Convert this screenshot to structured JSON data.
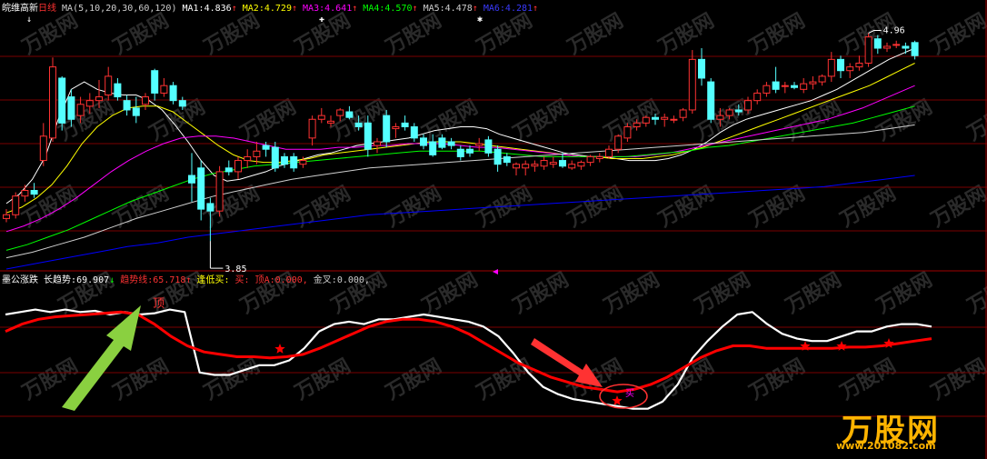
{
  "colors": {
    "up": "#ff3232",
    "down": "#54ffff",
    "grid": "#7a0000",
    "bg": "#000000",
    "ma1": "#ffffff",
    "ma2": "#ffff00",
    "ma3": "#ff00ff",
    "ma4": "#00ff00",
    "ma5": "#cfcfcf",
    "ma6": "#0000ff",
    "long_trend": "#ffffff",
    "trend_line": "#ff0000",
    "star": "#ff0000"
  },
  "upper": {
    "stock_name": "皖维高新",
    "period": "日线",
    "ma_params": "MA(5,10,20,30,60,120)",
    "ma_values": [
      {
        "label": "MA1:",
        "value": "4.836",
        "arrow": "↑"
      },
      {
        "label": "MA2:",
        "value": "4.729",
        "arrow": "↑"
      },
      {
        "label": "MA3:",
        "value": "4.641",
        "arrow": "↑"
      },
      {
        "label": "MA4:",
        "value": "4.570",
        "arrow": "↑"
      },
      {
        "label": "MA5:",
        "value": "4.478",
        "arrow": "↑"
      },
      {
        "label": "MA6:",
        "value": "4.281",
        "arrow": "↑"
      }
    ],
    "high_label": "4.96",
    "low_label": "3.85"
  },
  "lower": {
    "indicator_name": "墨公涨跌",
    "long_trend_label": "长趋势:",
    "long_trend_value": "69.907",
    "long_trend_arrow": "↓",
    "trend_line_label": "趋势线:",
    "trend_line_value": "65.718",
    "trend_line_arrow": "↑",
    "buy_low_label": "逢低买:",
    "buy_label": "买:",
    "top_label": "顶A:",
    "top_value": "0.000,",
    "golden_label": "金叉:",
    "golden_value": "0.000,",
    "top_marker": "顶",
    "buy_marker": "买"
  },
  "watermark": {
    "brand": "万股网",
    "url": "www.201082.com"
  },
  "chart_data": {
    "type": "candlestick",
    "price_range": [
      3.7,
      5.05
    ],
    "candles": [
      {
        "o": 3.97,
        "h": 4.02,
        "l": 3.95,
        "c": 3.99
      },
      {
        "o": 3.99,
        "h": 4.11,
        "l": 3.97,
        "c": 4.09
      },
      {
        "o": 4.09,
        "h": 4.15,
        "l": 4.06,
        "c": 4.12
      },
      {
        "o": 4.12,
        "h": 4.16,
        "l": 4.08,
        "c": 4.1
      },
      {
        "o": 4.28,
        "h": 4.48,
        "l": 4.25,
        "c": 4.41
      },
      {
        "o": 4.4,
        "h": 4.83,
        "l": 4.38,
        "c": 4.78
      },
      {
        "o": 4.72,
        "h": 4.73,
        "l": 4.44,
        "c": 4.48
      },
      {
        "o": 4.62,
        "h": 4.66,
        "l": 4.46,
        "c": 4.5
      },
      {
        "o": 4.52,
        "h": 4.62,
        "l": 4.48,
        "c": 4.58
      },
      {
        "o": 4.57,
        "h": 4.64,
        "l": 4.53,
        "c": 4.6
      },
      {
        "o": 4.6,
        "h": 4.71,
        "l": 4.56,
        "c": 4.62
      },
      {
        "o": 4.63,
        "h": 4.78,
        "l": 4.6,
        "c": 4.73
      },
      {
        "o": 4.69,
        "h": 4.72,
        "l": 4.6,
        "c": 4.62
      },
      {
        "o": 4.6,
        "h": 4.63,
        "l": 4.52,
        "c": 4.55
      },
      {
        "o": 4.56,
        "h": 4.62,
        "l": 4.48,
        "c": 4.52
      },
      {
        "o": 4.58,
        "h": 4.64,
        "l": 4.55,
        "c": 4.62
      },
      {
        "o": 4.76,
        "h": 4.77,
        "l": 4.6,
        "c": 4.64
      },
      {
        "o": 4.64,
        "h": 4.72,
        "l": 4.62,
        "c": 4.68
      },
      {
        "o": 4.68,
        "h": 4.7,
        "l": 4.58,
        "c": 4.6
      },
      {
        "o": 4.6,
        "h": 4.62,
        "l": 4.55,
        "c": 4.57
      },
      {
        "o": 4.2,
        "h": 4.32,
        "l": 4.06,
        "c": 4.16
      },
      {
        "o": 4.24,
        "h": 4.28,
        "l": 3.96,
        "c": 4.02
      },
      {
        "o": 4.05,
        "h": 4.08,
        "l": 3.85,
        "c": 4.01
      },
      {
        "o": 4.01,
        "h": 4.25,
        "l": 3.98,
        "c": 4.22
      },
      {
        "o": 4.24,
        "h": 4.28,
        "l": 4.2,
        "c": 4.22
      },
      {
        "o": 4.22,
        "h": 4.3,
        "l": 4.18,
        "c": 4.28
      },
      {
        "o": 4.28,
        "h": 4.34,
        "l": 4.24,
        "c": 4.3
      },
      {
        "o": 4.3,
        "h": 4.38,
        "l": 4.26,
        "c": 4.33
      },
      {
        "o": 4.36,
        "h": 4.38,
        "l": 4.3,
        "c": 4.34
      },
      {
        "o": 4.35,
        "h": 4.38,
        "l": 4.22,
        "c": 4.24
      },
      {
        "o": 4.3,
        "h": 4.32,
        "l": 4.24,
        "c": 4.26
      },
      {
        "o": 4.3,
        "h": 4.32,
        "l": 4.22,
        "c": 4.24
      },
      {
        "o": 4.26,
        "h": 4.3,
        "l": 4.24,
        "c": 4.28
      },
      {
        "o": 4.4,
        "h": 4.52,
        "l": 4.36,
        "c": 4.5
      },
      {
        "o": 4.5,
        "h": 4.56,
        "l": 4.48,
        "c": 4.52
      },
      {
        "o": 4.48,
        "h": 4.52,
        "l": 4.46,
        "c": 4.49
      },
      {
        "o": 4.52,
        "h": 4.56,
        "l": 4.49,
        "c": 4.55
      },
      {
        "o": 4.54,
        "h": 4.57,
        "l": 4.5,
        "c": 4.51
      },
      {
        "o": 4.48,
        "h": 4.52,
        "l": 4.44,
        "c": 4.46
      },
      {
        "o": 4.48,
        "h": 4.52,
        "l": 4.3,
        "c": 4.34
      },
      {
        "o": 4.36,
        "h": 4.4,
        "l": 4.32,
        "c": 4.38
      },
      {
        "o": 4.52,
        "h": 4.55,
        "l": 4.35,
        "c": 4.38
      },
      {
        "o": 4.45,
        "h": 4.48,
        "l": 4.4,
        "c": 4.46
      },
      {
        "o": 4.48,
        "h": 4.52,
        "l": 4.44,
        "c": 4.46
      },
      {
        "o": 4.46,
        "h": 4.48,
        "l": 4.38,
        "c": 4.4
      },
      {
        "o": 4.4,
        "h": 4.42,
        "l": 4.34,
        "c": 4.36
      },
      {
        "o": 4.38,
        "h": 4.42,
        "l": 4.3,
        "c": 4.31
      },
      {
        "o": 4.4,
        "h": 4.42,
        "l": 4.34,
        "c": 4.35
      },
      {
        "o": 4.38,
        "h": 4.4,
        "l": 4.34,
        "c": 4.36
      },
      {
        "o": 4.34,
        "h": 4.36,
        "l": 4.28,
        "c": 4.3
      },
      {
        "o": 4.34,
        "h": 4.36,
        "l": 4.3,
        "c": 4.32
      },
      {
        "o": 4.36,
        "h": 4.4,
        "l": 4.33,
        "c": 4.37
      },
      {
        "o": 4.39,
        "h": 4.41,
        "l": 4.3,
        "c": 4.32
      },
      {
        "o": 4.34,
        "h": 4.36,
        "l": 4.22,
        "c": 4.26
      },
      {
        "o": 4.3,
        "h": 4.32,
        "l": 4.25,
        "c": 4.27
      },
      {
        "o": 4.24,
        "h": 4.27,
        "l": 4.2,
        "c": 4.26
      },
      {
        "o": 4.24,
        "h": 4.28,
        "l": 4.2,
        "c": 4.26
      },
      {
        "o": 4.25,
        "h": 4.28,
        "l": 4.22,
        "c": 4.26
      },
      {
        "o": 4.25,
        "h": 4.3,
        "l": 4.23,
        "c": 4.28
      },
      {
        "o": 4.26,
        "h": 4.3,
        "l": 4.24,
        "c": 4.27
      },
      {
        "o": 4.28,
        "h": 4.32,
        "l": 4.24,
        "c": 4.25
      },
      {
        "o": 4.24,
        "h": 4.28,
        "l": 4.23,
        "c": 4.26
      },
      {
        "o": 4.25,
        "h": 4.28,
        "l": 4.23,
        "c": 4.27
      },
      {
        "o": 4.27,
        "h": 4.31,
        "l": 4.25,
        "c": 4.3
      },
      {
        "o": 4.29,
        "h": 4.32,
        "l": 4.27,
        "c": 4.3
      },
      {
        "o": 4.3,
        "h": 4.36,
        "l": 4.29,
        "c": 4.34
      },
      {
        "o": 4.34,
        "h": 4.42,
        "l": 4.32,
        "c": 4.41
      },
      {
        "o": 4.4,
        "h": 4.48,
        "l": 4.38,
        "c": 4.46
      },
      {
        "o": 4.46,
        "h": 4.5,
        "l": 4.44,
        "c": 4.48
      },
      {
        "o": 4.48,
        "h": 4.52,
        "l": 4.46,
        "c": 4.51
      },
      {
        "o": 4.51,
        "h": 4.53,
        "l": 4.47,
        "c": 4.5
      },
      {
        "o": 4.5,
        "h": 4.53,
        "l": 4.46,
        "c": 4.51
      },
      {
        "o": 4.5,
        "h": 4.52,
        "l": 4.48,
        "c": 4.5
      },
      {
        "o": 4.51,
        "h": 4.56,
        "l": 4.49,
        "c": 4.55
      },
      {
        "o": 4.55,
        "h": 4.87,
        "l": 4.53,
        "c": 4.82
      },
      {
        "o": 4.82,
        "h": 4.88,
        "l": 4.68,
        "c": 4.72
      },
      {
        "o": 4.7,
        "h": 4.72,
        "l": 4.48,
        "c": 4.5
      },
      {
        "o": 4.5,
        "h": 4.56,
        "l": 4.46,
        "c": 4.52
      },
      {
        "o": 4.52,
        "h": 4.56,
        "l": 4.5,
        "c": 4.55
      },
      {
        "o": 4.55,
        "h": 4.58,
        "l": 4.52,
        "c": 4.54
      },
      {
        "o": 4.55,
        "h": 4.62,
        "l": 4.53,
        "c": 4.6
      },
      {
        "o": 4.6,
        "h": 4.66,
        "l": 4.58,
        "c": 4.64
      },
      {
        "o": 4.64,
        "h": 4.7,
        "l": 4.62,
        "c": 4.68
      },
      {
        "o": 4.7,
        "h": 4.78,
        "l": 4.64,
        "c": 4.66
      },
      {
        "o": 4.68,
        "h": 4.7,
        "l": 4.64,
        "c": 4.68
      },
      {
        "o": 4.68,
        "h": 4.7,
        "l": 4.66,
        "c": 4.67
      },
      {
        "o": 4.66,
        "h": 4.72,
        "l": 4.64,
        "c": 4.69
      },
      {
        "o": 4.69,
        "h": 4.73,
        "l": 4.66,
        "c": 4.7
      },
      {
        "o": 4.7,
        "h": 4.74,
        "l": 4.68,
        "c": 4.73
      },
      {
        "o": 4.73,
        "h": 4.86,
        "l": 4.7,
        "c": 4.82
      },
      {
        "o": 4.82,
        "h": 4.84,
        "l": 4.72,
        "c": 4.76
      },
      {
        "o": 4.76,
        "h": 4.8,
        "l": 4.72,
        "c": 4.78
      },
      {
        "o": 4.78,
        "h": 4.84,
        "l": 4.76,
        "c": 4.8
      },
      {
        "o": 4.8,
        "h": 4.96,
        "l": 4.78,
        "c": 4.94
      },
      {
        "o": 4.93,
        "h": 4.95,
        "l": 4.85,
        "c": 4.88
      },
      {
        "o": 4.88,
        "h": 4.91,
        "l": 4.86,
        "c": 4.89
      },
      {
        "o": 4.9,
        "h": 4.92,
        "l": 4.88,
        "c": 4.9
      },
      {
        "o": 4.89,
        "h": 4.91,
        "l": 4.85,
        "c": 4.88
      },
      {
        "o": 4.91,
        "h": 4.92,
        "l": 4.82,
        "c": 4.84
      }
    ],
    "ma_series": [
      {
        "name": "MA1",
        "values": [
          4.05,
          4.1,
          4.18,
          4.3,
          4.5,
          4.66,
          4.7,
          4.66,
          4.64,
          4.63,
          4.63,
          4.6,
          4.55,
          4.47,
          4.38,
          4.28,
          4.2,
          4.17,
          4.18,
          4.2,
          4.22,
          4.25,
          4.27,
          4.29,
          4.31,
          4.32,
          4.34,
          4.36,
          4.37,
          4.38,
          4.39,
          4.4,
          4.42,
          4.44,
          4.45,
          4.46,
          4.46,
          4.45,
          4.42,
          4.4,
          4.38,
          4.36,
          4.34,
          4.32,
          4.31,
          4.3,
          4.3,
          4.29,
          4.28,
          4.28,
          4.28,
          4.29,
          4.31,
          4.34,
          4.38,
          4.43,
          4.47,
          4.5,
          4.52,
          4.54,
          4.56,
          4.58,
          4.6,
          4.63,
          4.66,
          4.7,
          4.74,
          4.78,
          4.82,
          4.85,
          4.88
        ]
      },
      {
        "name": "MA2",
        "values": [
          4.0,
          4.03,
          4.08,
          4.15,
          4.25,
          4.37,
          4.46,
          4.52,
          4.56,
          4.57,
          4.57,
          4.54,
          4.48,
          4.42,
          4.36,
          4.31,
          4.28,
          4.27,
          4.27,
          4.28,
          4.29,
          4.31,
          4.32,
          4.33,
          4.34,
          4.35,
          4.36,
          4.37,
          4.38,
          4.38,
          4.38,
          4.37,
          4.36,
          4.35,
          4.34,
          4.33,
          4.32,
          4.31,
          4.3,
          4.3,
          4.29,
          4.29,
          4.29,
          4.3,
          4.31,
          4.33,
          4.35,
          4.38,
          4.41,
          4.44,
          4.47,
          4.5,
          4.53,
          4.56,
          4.59,
          4.62,
          4.65,
          4.68,
          4.72,
          4.76,
          4.8
        ]
      },
      {
        "name": "MA3",
        "values": [
          3.9,
          3.93,
          3.97,
          4.02,
          4.08,
          4.15,
          4.22,
          4.28,
          4.33,
          4.37,
          4.4,
          4.41,
          4.41,
          4.4,
          4.38,
          4.36,
          4.34,
          4.34,
          4.34,
          4.35,
          4.35,
          4.36,
          4.36,
          4.37,
          4.37,
          4.37,
          4.36,
          4.35,
          4.35,
          4.34,
          4.33,
          4.32,
          4.31,
          4.3,
          4.3,
          4.3,
          4.3,
          4.31,
          4.32,
          4.34,
          4.36,
          4.38,
          4.4,
          4.42,
          4.44,
          4.46,
          4.48,
          4.5,
          4.53,
          4.56,
          4.6,
          4.64,
          4.68
        ]
      },
      {
        "name": "MA4",
        "values": [
          3.8,
          3.83,
          3.87,
          3.91,
          3.96,
          4.01,
          4.06,
          4.1,
          4.14,
          4.18,
          4.21,
          4.23,
          4.25,
          4.26,
          4.27,
          4.28,
          4.29,
          4.3,
          4.31,
          4.32,
          4.33,
          4.33,
          4.33,
          4.33,
          4.32,
          4.31,
          4.3,
          4.3,
          4.3,
          4.3,
          4.3,
          4.31,
          4.32,
          4.33,
          4.35,
          4.36,
          4.38,
          4.4,
          4.42,
          4.44,
          4.46,
          4.48,
          4.51,
          4.54,
          4.57
        ]
      },
      {
        "name": "MA5",
        "values": [
          3.76,
          3.79,
          3.83,
          3.87,
          3.92,
          3.97,
          4.01,
          4.05,
          4.09,
          4.12,
          4.15,
          4.18,
          4.2,
          4.22,
          4.24,
          4.25,
          4.26,
          4.27,
          4.28,
          4.29,
          4.3,
          4.31,
          4.32,
          4.33,
          4.34,
          4.35,
          4.36,
          4.37,
          4.38,
          4.39,
          4.4,
          4.41,
          4.42,
          4.43,
          4.45,
          4.47
        ]
      },
      {
        "name": "MA6",
        "values": [
          3.7,
          3.73,
          3.76,
          3.79,
          3.82,
          3.84,
          3.87,
          3.89,
          3.91,
          3.93,
          3.95,
          3.97,
          3.99,
          4.0,
          4.01,
          4.02,
          4.03,
          4.04,
          4.05,
          4.06,
          4.07,
          4.08,
          4.09,
          4.1,
          4.11,
          4.12,
          4.13,
          4.14,
          4.16,
          4.18,
          4.2
        ]
      }
    ],
    "indicator": {
      "range": [
        0,
        100
      ],
      "long_trend": [
        88,
        90,
        92,
        90,
        92,
        90,
        91,
        88,
        90,
        88,
        89,
        92,
        90,
        40,
        38,
        38,
        42,
        46,
        46,
        50,
        60,
        74,
        80,
        82,
        80,
        84,
        84,
        86,
        88,
        86,
        84,
        82,
        78,
        70,
        56,
        40,
        28,
        22,
        18,
        16,
        14,
        12,
        10,
        10,
        16,
        30,
        52,
        66,
        78,
        88,
        90,
        80,
        72,
        68,
        66,
        66,
        70,
        74,
        74,
        78,
        80,
        80,
        78
      ],
      "trend_line": [
        74,
        80,
        84,
        86,
        87,
        88,
        89,
        90,
        88,
        80,
        70,
        62,
        57,
        55,
        53,
        53,
        52,
        53,
        55,
        60,
        66,
        72,
        78,
        82,
        84,
        84,
        82,
        78,
        72,
        64,
        56,
        48,
        42,
        36,
        32,
        28,
        26,
        24,
        26,
        30,
        36,
        44,
        52,
        58,
        62,
        62,
        60,
        60,
        60,
        60,
        60,
        61,
        61,
        62,
        64,
        66,
        68
      ]
    }
  }
}
